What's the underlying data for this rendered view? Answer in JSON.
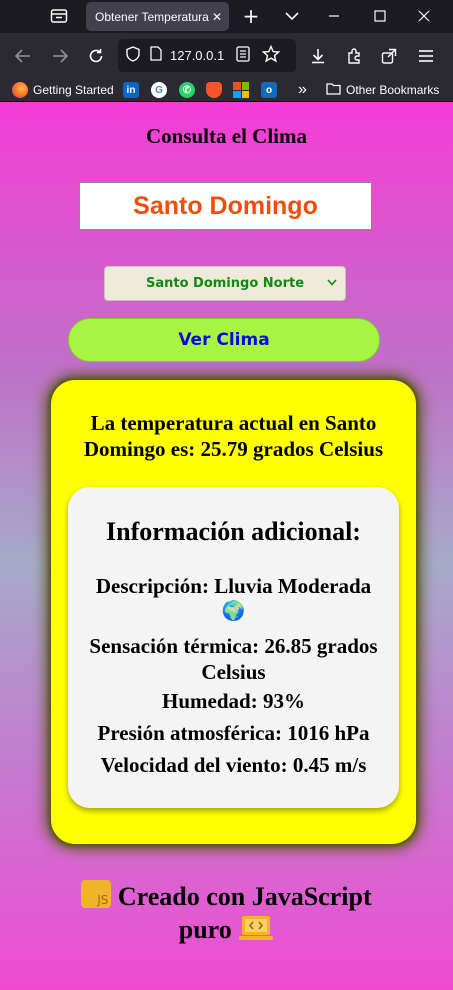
{
  "browser": {
    "tab_title": "Obtener Temperatura",
    "tab_close": "✕",
    "url": "127.0.0.1",
    "bookmarks": [
      {
        "label": "Getting Started",
        "icon": "firefox-icon"
      },
      {
        "label": "",
        "icon": "linkedin-icon"
      },
      {
        "label": "",
        "icon": "google-icon"
      },
      {
        "label": "",
        "icon": "whatsapp-icon"
      },
      {
        "label": "",
        "icon": "brave-icon"
      },
      {
        "label": "",
        "icon": "microsoft-icon"
      },
      {
        "label": "",
        "icon": "outlook-icon"
      }
    ],
    "overflow_label": "»",
    "other_bookmarks": "Other Bookmarks"
  },
  "page": {
    "title": "Consulta el Clima",
    "city_value": "Santo Domingo",
    "select_value": "Santo Domingo Norte",
    "button_label": "Ver Clima",
    "temperature_text": "La temperatura actual en Santo Domingo es: 25.79 grados Celsius",
    "info": {
      "title": "Información adicional:",
      "description": "Descripción: Lluvia Moderada",
      "description_icon": "🌍",
      "feels_like_1": "Sensación térmica: 26.85 grados",
      "feels_like_2": "Celsius",
      "humidity": "Humedad: 93%",
      "pressure": "Presión atmosférica: 1016 hPa",
      "wind": "Velocidad del viento: 0.45 m/s"
    },
    "footer_line1": "Creado con JavaScript",
    "footer_line2": "puro",
    "js_badge_text": "JS"
  },
  "colors": {
    "accent_input_text": "#ef4e0d",
    "button_bg": "#a7f542",
    "button_text": "#0a0adb",
    "card_bg": "#ffff00",
    "select_text": "#128a12"
  }
}
